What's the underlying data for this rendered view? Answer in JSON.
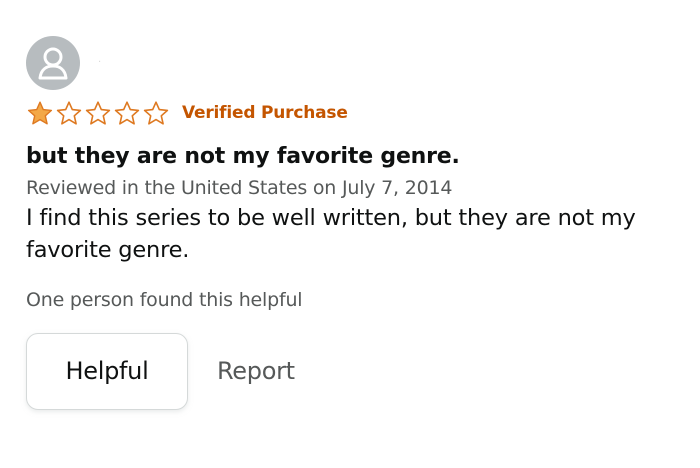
{
  "review": {
    "profile_name": "·",
    "rating": {
      "value": 1,
      "max": 5,
      "filled_color": "#f3a847",
      "empty_color": "#de7921"
    },
    "verified_label": "Verified Purchase",
    "title": "but they are not my favorite genre.",
    "meta": "Reviewed in the United States on July 7, 2014",
    "body": "I find this series to be well written, but they are not my favorite genre.",
    "helpful_count": "One person found this helpful",
    "helpful_button": "Helpful",
    "report_link": "Report"
  },
  "icons": {
    "avatar": "user-avatar-icon",
    "star_filled": "star-filled-icon",
    "star_empty": "star-empty-icon"
  },
  "colors": {
    "verified": "#c45500",
    "secondary_text": "#565959",
    "primary_text": "#0f1111",
    "avatar_bg": "#b7bcbf"
  }
}
